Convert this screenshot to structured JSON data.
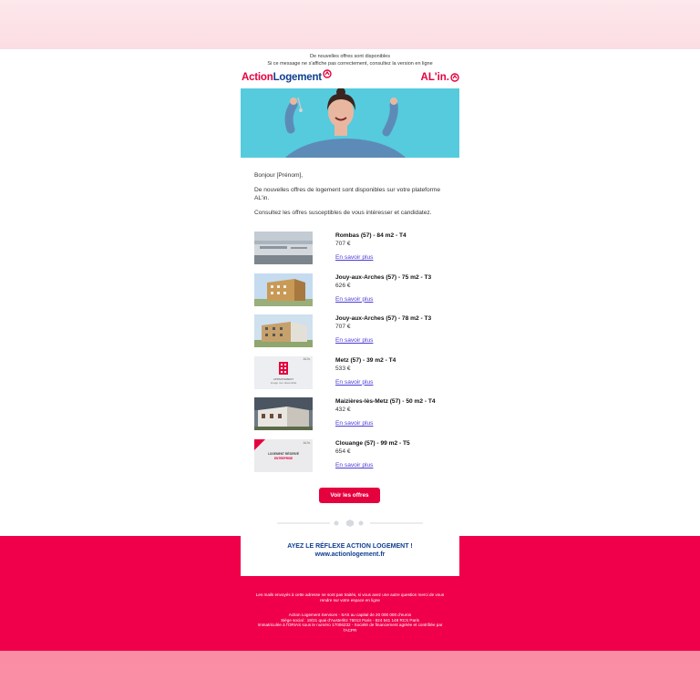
{
  "preheader": {
    "line1": "De nouvelles offres sont disponibles",
    "line2": "Si ce message ne s'affiche pas correctement, consultez la version en ligne"
  },
  "brand": {
    "left_logo_part1": "Action",
    "left_logo_part2": "Logement",
    "right_logo": "AL'in.",
    "accent_color": "#e5003e",
    "blue_color": "#0f3f91"
  },
  "intro": {
    "greeting": "Bonjour [Prénom],",
    "para1": "De nouvelles offres de logement sont disponibles sur votre plateforme AL'in.",
    "para2": "Consultez les offres susceptibles de vous intéresser et candidatez."
  },
  "offers": [
    {
      "title": "Rombas (57) - 84 m2 - T4",
      "price": "707 €",
      "link": "En savoir plus",
      "thumb": "building-photo"
    },
    {
      "title": "Jouy-aux-Arches (57) - 75 m2 - T3",
      "price": "626 €",
      "link": "En savoir plus",
      "thumb": "building-photo"
    },
    {
      "title": "Jouy-aux-Arches (57) - 78 m2 - T3",
      "price": "707 €",
      "link": "En savoir plus",
      "thumb": "building-photo"
    },
    {
      "title": "Metz (57) - 39 m2 - T4",
      "price": "533 €",
      "link": "En savoir plus",
      "thumb": "placeholder",
      "placeholder_text1": "APPARTEMENT",
      "placeholder_text2": "Image non disponible",
      "placeholder_logo": "AL'in."
    },
    {
      "title": "Maizières-lès-Metz  (57) - 50 m2 - T4",
      "price": "432 €",
      "link": "En savoir plus",
      "thumb": "building-photo"
    },
    {
      "title": "Clouange (57) - 99 m2 - T5",
      "price": "654 €",
      "link": "En savoir plus",
      "thumb": "reserved",
      "reserved_text1": "LOGEMENT RÉSERVÉ",
      "reserved_text2": "ENTREPRISE",
      "placeholder_logo": "AL'in."
    }
  ],
  "cta": {
    "label": "Voir les offres"
  },
  "footer": {
    "slogan": "AYEZ LE RÉFLEXE ACTION LOGEMENT !",
    "site": "www.actionlogement.fr",
    "legal1": "Les mails envoyés à cette adresse ne sont pas traités, si vous avez une autre question merci de vous rendre sur votre espace en ligne",
    "legal2_line1": "Action Logement Services - SAS au capital de 20 000 000 d'euros",
    "legal2_line2": "Siège social : 19/21 quai d'Austerlitz 75013 Paris - 824 541 148 RCS Paris",
    "legal2_line3": "Immatriculée à l'ORIAS sous le numéro 17006232 - Société de financement agréée et contrôlée par l'ACPR"
  }
}
